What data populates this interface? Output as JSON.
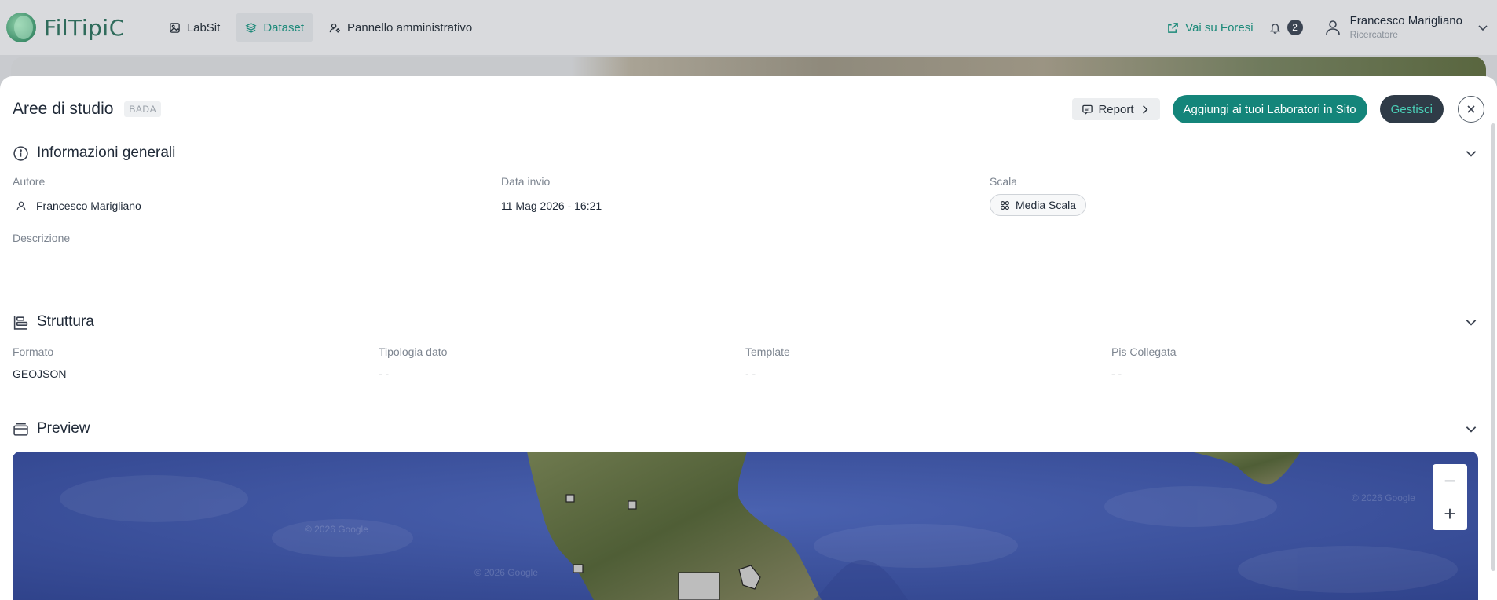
{
  "app": {
    "name": "FilTipiC"
  },
  "nav": {
    "items": [
      {
        "label": "LabSit",
        "icon": "image-icon",
        "active": false
      },
      {
        "label": "Dataset",
        "icon": "layers-icon",
        "active": true
      },
      {
        "label": "Pannello amministrativo",
        "icon": "user-settings-icon",
        "active": false
      }
    ]
  },
  "topbar": {
    "external_link": "Vai su Foresi",
    "notifications_count": "2",
    "user_name": "Francesco Marigliano",
    "user_role": "Ricercatore"
  },
  "header": {
    "title": "Aree di studio",
    "tag": "BADA",
    "report_label": "Report",
    "add_label": "Aggiungi ai tuoi Laboratori in Sito",
    "manage_label": "Gestisci"
  },
  "info": {
    "title": "Informazioni generali",
    "author_label": "Autore",
    "author_value": "Francesco Marigliano",
    "date_label": "Data invio",
    "date_value": "11 Mag 2026 - 16:21",
    "scale_label": "Scala",
    "scale_value": "Media Scala",
    "description_label": "Descrizione"
  },
  "structure": {
    "title": "Struttura",
    "format_label": "Formato",
    "format_value": "GEOJSON",
    "type_label": "Tipologia dato",
    "type_value": "- -",
    "template_label": "Template",
    "template_value": "- -",
    "pis_label": "Pis Collegata",
    "pis_value": "- -"
  },
  "preview": {
    "title": "Preview",
    "zoom_out": "−",
    "zoom_in": "+",
    "watermark": "© 2026 Google"
  },
  "colors": {
    "accent": "#14857a",
    "dark_button": "#2f3b47",
    "sea": "#3a4e9a"
  }
}
